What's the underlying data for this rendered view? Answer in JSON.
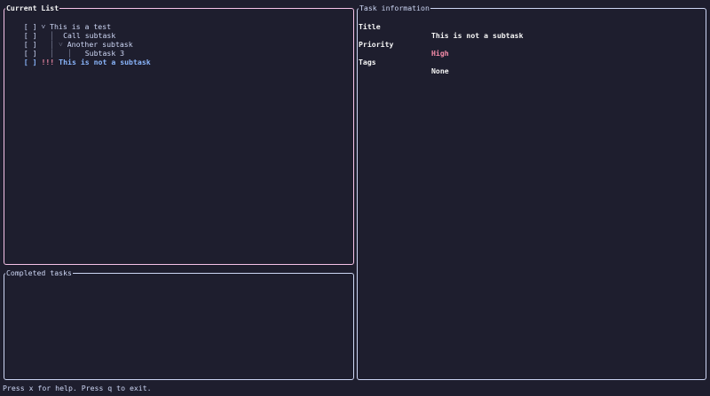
{
  "current_list": {
    "title": "Current List",
    "tasks": [
      {
        "checkbox": "[ ]",
        "prefix": " ˅ ",
        "title": "This is a test"
      },
      {
        "checkbox": "[ ]",
        "prefix": "   │  ",
        "title": "Call subtask"
      },
      {
        "checkbox": "[ ]",
        "prefix": "   │ ˅ ",
        "title": "Another subtask"
      },
      {
        "checkbox": "[ ]",
        "prefix": "   │   │   ",
        "title": "Subtask 3"
      },
      {
        "checkbox": "[ ]",
        "prefix": " ",
        "priority": "!!!",
        "title": " This is not a subtask"
      }
    ]
  },
  "completed": {
    "title": "Completed tasks"
  },
  "task_info": {
    "title": "Task information",
    "fields": [
      {
        "label": "Title",
        "value": "This is not a subtask"
      },
      {
        "label": "Priority",
        "value": "High"
      },
      {
        "label": "Tags",
        "value": "None"
      }
    ]
  },
  "status_bar": "Press x for help. Press q to exit.",
  "colors": {
    "background": "#1e1e2e",
    "active_border": "#f5c2e7",
    "selected_text": "#89b4fa",
    "priority_high": "#f38ba8"
  }
}
